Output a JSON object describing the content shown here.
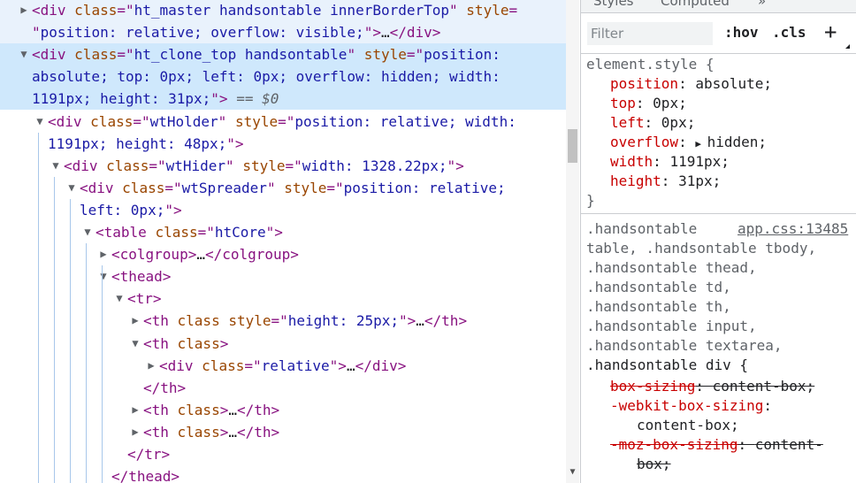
{
  "dom_lines": [
    {
      "indent": 0,
      "toggle": "▶",
      "hl": "hl-light",
      "parts": [
        {
          "c": "tag",
          "t": "<div "
        },
        {
          "c": "attr",
          "t": "class"
        },
        {
          "c": "tag",
          "t": "=\""
        },
        {
          "c": "val",
          "t": "ht_master handsontable innerBorderTop"
        },
        {
          "c": "tag",
          "t": "\" "
        },
        {
          "c": "attr",
          "t": "style"
        },
        {
          "c": "tag",
          "t": "="
        }
      ]
    },
    {
      "indent": 0,
      "toggle": "",
      "hl": "hl-light",
      "cont": true,
      "parts": [
        {
          "c": "tag",
          "t": "\""
        },
        {
          "c": "val",
          "t": "position: relative; overflow: visible;"
        },
        {
          "c": "tag",
          "t": "\">"
        },
        {
          "c": "txt",
          "t": "…"
        },
        {
          "c": "tag",
          "t": "</div>"
        }
      ]
    },
    {
      "indent": 0,
      "toggle": "▼",
      "hl": "hl-sel",
      "parts": [
        {
          "c": "tag",
          "t": "<div "
        },
        {
          "c": "attr",
          "t": "class"
        },
        {
          "c": "tag",
          "t": "=\""
        },
        {
          "c": "val",
          "t": "ht_clone_top handsontable"
        },
        {
          "c": "tag",
          "t": "\" "
        },
        {
          "c": "attr",
          "t": "style"
        },
        {
          "c": "tag",
          "t": "=\""
        },
        {
          "c": "val",
          "t": "position:"
        }
      ]
    },
    {
      "indent": 0,
      "toggle": "",
      "hl": "hl-sel",
      "cont": true,
      "parts": [
        {
          "c": "val",
          "t": "absolute; top: 0px; left: 0px; overflow: hidden; width:"
        }
      ]
    },
    {
      "indent": 0,
      "toggle": "",
      "hl": "hl-sel",
      "cont": true,
      "parts": [
        {
          "c": "val",
          "t": "1191px; height: 31px;"
        },
        {
          "c": "tag",
          "t": "\">"
        },
        {
          "c": "dim",
          "t": " == $0"
        }
      ]
    },
    {
      "indent": 1,
      "toggle": "▼",
      "hl": "",
      "parts": [
        {
          "c": "tag",
          "t": "<div "
        },
        {
          "c": "attr",
          "t": "class"
        },
        {
          "c": "tag",
          "t": "=\""
        },
        {
          "c": "val",
          "t": "wtHolder"
        },
        {
          "c": "tag",
          "t": "\" "
        },
        {
          "c": "attr",
          "t": "style"
        },
        {
          "c": "tag",
          "t": "=\""
        },
        {
          "c": "val",
          "t": "position: relative; width:"
        }
      ]
    },
    {
      "indent": 1,
      "toggle": "",
      "hl": "",
      "cont": true,
      "parts": [
        {
          "c": "val",
          "t": "1191px; height: 48px;"
        },
        {
          "c": "tag",
          "t": "\">"
        }
      ]
    },
    {
      "indent": 2,
      "toggle": "▼",
      "hl": "",
      "parts": [
        {
          "c": "tag",
          "t": "<div "
        },
        {
          "c": "attr",
          "t": "class"
        },
        {
          "c": "tag",
          "t": "=\""
        },
        {
          "c": "val",
          "t": "wtHider"
        },
        {
          "c": "tag",
          "t": "\" "
        },
        {
          "c": "attr",
          "t": "style"
        },
        {
          "c": "tag",
          "t": "=\""
        },
        {
          "c": "val",
          "t": "width: 1328.22px;"
        },
        {
          "c": "tag",
          "t": "\">"
        }
      ]
    },
    {
      "indent": 3,
      "toggle": "▼",
      "hl": "",
      "parts": [
        {
          "c": "tag",
          "t": "<div "
        },
        {
          "c": "attr",
          "t": "class"
        },
        {
          "c": "tag",
          "t": "=\""
        },
        {
          "c": "val",
          "t": "wtSpreader"
        },
        {
          "c": "tag",
          "t": "\" "
        },
        {
          "c": "attr",
          "t": "style"
        },
        {
          "c": "tag",
          "t": "=\""
        },
        {
          "c": "val",
          "t": "position: relative;"
        }
      ]
    },
    {
      "indent": 3,
      "toggle": "",
      "hl": "",
      "cont": true,
      "parts": [
        {
          "c": "val",
          "t": "left: 0px;"
        },
        {
          "c": "tag",
          "t": "\">"
        }
      ]
    },
    {
      "indent": 4,
      "toggle": "▼",
      "hl": "",
      "parts": [
        {
          "c": "tag",
          "t": "<table "
        },
        {
          "c": "attr",
          "t": "class"
        },
        {
          "c": "tag",
          "t": "=\""
        },
        {
          "c": "val",
          "t": "htCore"
        },
        {
          "c": "tag",
          "t": "\">"
        }
      ]
    },
    {
      "indent": 5,
      "toggle": "▶",
      "hl": "",
      "parts": [
        {
          "c": "tag",
          "t": "<colgroup>"
        },
        {
          "c": "txt",
          "t": "…"
        },
        {
          "c": "tag",
          "t": "</colgroup>"
        }
      ]
    },
    {
      "indent": 5,
      "toggle": "▼",
      "hl": "",
      "parts": [
        {
          "c": "tag",
          "t": "<thead>"
        }
      ]
    },
    {
      "indent": 6,
      "toggle": "▼",
      "hl": "",
      "parts": [
        {
          "c": "tag",
          "t": "<tr>"
        }
      ]
    },
    {
      "indent": 7,
      "toggle": "▶",
      "hl": "",
      "parts": [
        {
          "c": "tag",
          "t": "<th "
        },
        {
          "c": "attr",
          "t": "class style"
        },
        {
          "c": "tag",
          "t": "=\""
        },
        {
          "c": "val",
          "t": "height: 25px;"
        },
        {
          "c": "tag",
          "t": "\">"
        },
        {
          "c": "txt",
          "t": "…"
        },
        {
          "c": "tag",
          "t": "</th>"
        }
      ]
    },
    {
      "indent": 7,
      "toggle": "▼",
      "hl": "",
      "parts": [
        {
          "c": "tag",
          "t": "<th "
        },
        {
          "c": "attr",
          "t": "class"
        },
        {
          "c": "tag",
          "t": ">"
        }
      ]
    },
    {
      "indent": 8,
      "toggle": "▶",
      "hl": "",
      "parts": [
        {
          "c": "tag",
          "t": "<div "
        },
        {
          "c": "attr",
          "t": "class"
        },
        {
          "c": "tag",
          "t": "=\""
        },
        {
          "c": "val",
          "t": "relative"
        },
        {
          "c": "tag",
          "t": "\">"
        },
        {
          "c": "txt",
          "t": "…"
        },
        {
          "c": "tag",
          "t": "</div>"
        }
      ]
    },
    {
      "indent": 7,
      "toggle": "",
      "hl": "",
      "parts": [
        {
          "c": "tag",
          "t": "</th>"
        }
      ]
    },
    {
      "indent": 7,
      "toggle": "▶",
      "hl": "",
      "parts": [
        {
          "c": "tag",
          "t": "<th "
        },
        {
          "c": "attr",
          "t": "class"
        },
        {
          "c": "tag",
          "t": ">"
        },
        {
          "c": "txt",
          "t": "…"
        },
        {
          "c": "tag",
          "t": "</th>"
        }
      ]
    },
    {
      "indent": 7,
      "toggle": "▶",
      "hl": "",
      "parts": [
        {
          "c": "tag",
          "t": "<th "
        },
        {
          "c": "attr",
          "t": "class"
        },
        {
          "c": "tag",
          "t": ">"
        },
        {
          "c": "txt",
          "t": "…"
        },
        {
          "c": "tag",
          "t": "</th>"
        }
      ]
    },
    {
      "indent": 6,
      "toggle": "",
      "hl": "",
      "parts": [
        {
          "c": "tag",
          "t": "</tr>"
        }
      ]
    },
    {
      "indent": 5,
      "toggle": "",
      "hl": "",
      "parts": [
        {
          "c": "tag",
          "t": "</thead>"
        }
      ]
    }
  ],
  "styles": {
    "tabs": [
      "Styles",
      "Computed",
      "»"
    ],
    "filter_placeholder": "Filter",
    "hov_label": ":hov",
    "cls_label": ".cls",
    "plus_label": "+",
    "element_style_selector": "element.style {",
    "element_style_props": [
      {
        "name": "position",
        "value": "absolute;"
      },
      {
        "name": "top",
        "value": "0px;"
      },
      {
        "name": "left",
        "value": "0px;"
      },
      {
        "name": "overflow",
        "value": "hidden;",
        "expand": "▶"
      },
      {
        "name": "width",
        "value": "1191px;"
      },
      {
        "name": "height",
        "value": "31px;"
      }
    ],
    "close_brace": "}",
    "rule2_source": "app.css:13485",
    "rule2_selector_lines": [
      {
        "t": ".handsontable",
        "dim": true
      },
      {
        "t": "table, .handsontable tbody,",
        "dim": true
      },
      {
        "t": ".handsontable thead,",
        "dim": true
      },
      {
        "t": ".handsontable td,",
        "dim": true
      },
      {
        "t": ".handsontable th,",
        "dim": true
      },
      {
        "t": ".handsontable input,",
        "dim": true
      },
      {
        "t": ".handsontable textarea,",
        "dim": true
      },
      {
        "t": ".handsontable div {",
        "dim": false
      }
    ],
    "rule2_props": [
      {
        "name": "box-sizing",
        "value": "content-box;",
        "struck": true
      },
      {
        "name": "-webkit-box-sizing",
        "value": "",
        "struck": false
      },
      {
        "name": "",
        "value": "content-box;",
        "struck": false,
        "wrap": true
      },
      {
        "name": "-moz-box-sizing",
        "value": "content-",
        "struck": true
      },
      {
        "name": "",
        "value": "box;",
        "struck": true,
        "wrap": true
      }
    ]
  }
}
